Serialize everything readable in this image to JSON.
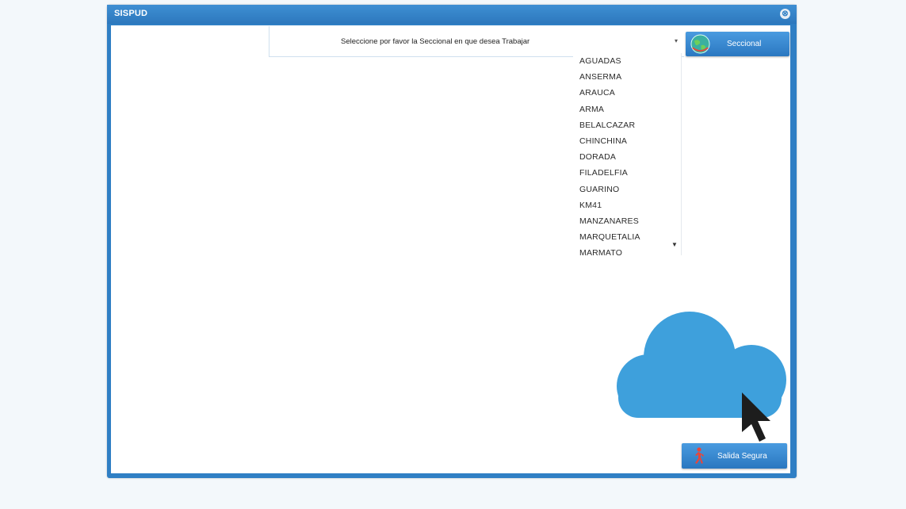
{
  "window": {
    "title": "SISPUD",
    "close_icon": "⊗"
  },
  "selector": {
    "label": "Seleccione por favor la Seccional en que desea Trabajar",
    "selected_value": "",
    "arrow_icon": "▾",
    "options": [
      "AGUADAS",
      "ANSERMA",
      "ARAUCA",
      "ARMA",
      "BELALCAZAR",
      "CHINCHINA",
      "DORADA",
      "FILADELFIA",
      "GUARINO",
      "KM41",
      "MANZANARES",
      "MARQUETALIA",
      "MARMATO"
    ]
  },
  "buttons": {
    "seccional_label": "Seccional",
    "seccional_icon": "globe-icon",
    "salida_label": "Salida Segura",
    "salida_icon": "exit-person-icon"
  },
  "colors": {
    "frame": "#2f7fc4",
    "button": "#2a77c0",
    "cloud": "#3ea0dc"
  }
}
